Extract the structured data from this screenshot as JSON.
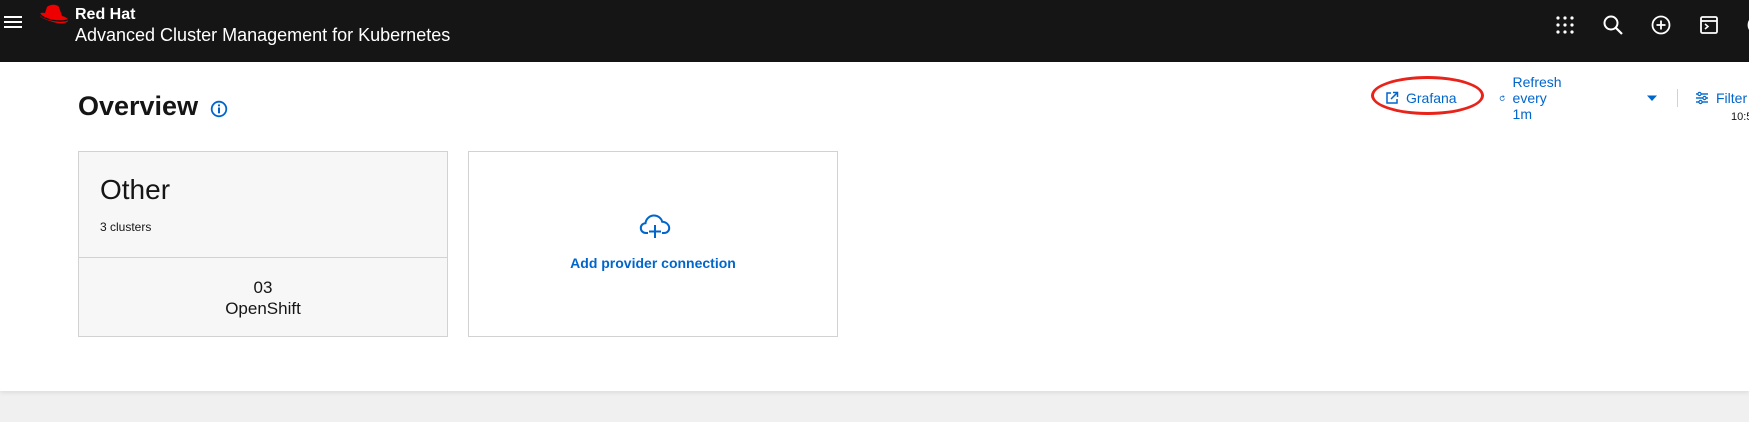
{
  "masthead": {
    "brand_name": "Red Hat",
    "product_name": "Advanced Cluster Management for Kubernetes",
    "tools": [
      "app-launcher-icon",
      "search-icon",
      "create-resource-icon",
      "terminal-icon",
      "help-icon"
    ]
  },
  "page": {
    "title": "Overview"
  },
  "toolbar": {
    "grafana_label": "Grafana",
    "refresh_label": "Refresh every 1m",
    "filter_label": "Filter",
    "timestamp": "10:5"
  },
  "providers": [
    {
      "name": "Other",
      "cluster_count_label": "3 clusters",
      "distributions": [
        {
          "count": "03",
          "name": "OpenShift"
        }
      ]
    }
  ],
  "add_provider": {
    "label": "Add provider connection"
  },
  "colors": {
    "masthead_bg": "#151515",
    "link": "#0066cc",
    "redhat_red": "#ee0000",
    "highlight": "#e8231a"
  }
}
